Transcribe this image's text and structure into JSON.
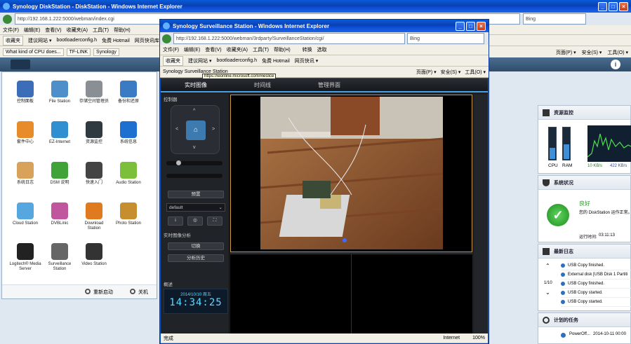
{
  "bg_window": {
    "title": "Synology DiskStation - DiskStation - Windows Internet Explorer",
    "address": "http://192.168.1.222:5000/webman/index.cgi",
    "search_placeholder": "Bing",
    "menu": [
      "文件(F)",
      "编辑(E)",
      "查看(V)",
      "收藏夹(A)",
      "工具(T)",
      "帮助(H)"
    ],
    "favorites_label": "收藏夹",
    "fav_links": [
      "建议网站 ▾",
      "bootloaderconfig.h",
      "免费 Hotmail",
      "网页快讯库 ▾"
    ],
    "tabs": [
      "What kind of CPU does...",
      "TF-LINK",
      "Synology"
    ],
    "right_tools": [
      "页面(P) ▾",
      "安全(S) ▾",
      "工具(O) ▾"
    ]
  },
  "dsm": {
    "apps": [
      {
        "label": "控制面板",
        "color": "#3b6db8"
      },
      {
        "label": "File Station",
        "color": "#4f8fc9"
      },
      {
        "label": "存储空间管理员",
        "color": "#8a8f96"
      },
      {
        "label": "备份和还原",
        "color": "#3a7bc4"
      },
      {
        "label": "套件中心",
        "color": "#e88b2a"
      },
      {
        "label": "EZ-Internet",
        "color": "#2f8fd0"
      },
      {
        "label": "资源监控",
        "color": "#2f3a40"
      },
      {
        "label": "系统信息",
        "color": "#1d6fd0"
      },
      {
        "label": "系统日志",
        "color": "#d9a25b"
      },
      {
        "label": "DSM 说明",
        "color": "#3fa33a"
      },
      {
        "label": "快速入门",
        "color": "#444"
      },
      {
        "label": "Audio Station",
        "color": "#7bbf3a"
      },
      {
        "label": "Cloud Station",
        "color": "#56a7e0"
      },
      {
        "label": "DVBLinic",
        "color": "#c0569e"
      },
      {
        "label": "Download Station",
        "color": "#e07a1f"
      },
      {
        "label": "Photo Station",
        "color": "#c68e2f"
      },
      {
        "label": "Logitech® Media Server",
        "color": "#222"
      },
      {
        "label": "Surveillance Station",
        "color": "#666"
      },
      {
        "label": "Video Station",
        "color": "#333"
      }
    ],
    "restart_label": "重新启动",
    "shutdown_label": "关机"
  },
  "ss_window": {
    "title": "Synology Surveillance Station - Windows Internet Explorer",
    "address": "http://192.168.1.222:5000/webman/3rdparty/SurveillanceStation/cgi/",
    "search_placeholder": "Bing",
    "menu": [
      "文件(F)",
      "编辑(E)",
      "查看(V)",
      "收藏夹(A)",
      "工具(T)",
      "帮助(H)"
    ],
    "translate_label": "转换",
    "select_label": "选取",
    "favorites_label": "收藏夹",
    "fav_links": [
      "建议网站 ▾",
      "bootloaderconfig.h",
      "免费 Hotmail",
      "网页快讯 ▾"
    ],
    "page_tab": "Synology Surveillance Station",
    "tooltip_url": "https://ieonline.microsoft.com/#ieslice",
    "right_tools": [
      "页面(P) ▾",
      "安全(S) ▾",
      "工具(O) ▾"
    ],
    "nav": [
      "实时图像",
      "时间线",
      "管理界面"
    ],
    "control_title": "控制器",
    "preset_label": "预置",
    "preset_value": "default",
    "analytics_title": "实时图像分析",
    "switch_label": "切换",
    "analytics_history": "分析历史",
    "overview_title": "概述",
    "clock_date": "2014/10/10 周五",
    "clock_time": "14:34:25",
    "status_done": "完成",
    "status_zone": "Internet",
    "zoom": "100%"
  },
  "widgets": {
    "resource_title": "资源监控",
    "cpu_label": "CPU",
    "ram_label": "RAM",
    "cpu_level": 0.35,
    "ram_level": 0.45,
    "upload": "10 KB/s",
    "download": "422 KB/s",
    "health_title": "系统状况",
    "health_status": "良好",
    "health_desc": "您的 DiskStation 运作正常。",
    "uptime_label": "运行时间:",
    "uptime_value": "03:11:13",
    "log_title": "最新日志",
    "log_page": "1/10",
    "logs": [
      "USB Copy finished.",
      "External disk [USB Disk 1 Partiti",
      "USB Copy finished.",
      "USB Copy started.",
      "USB Copy started."
    ],
    "task_title": "计划的任务",
    "task_name": "PowerOff...",
    "task_time": "2014-10-11 00:00"
  },
  "colors": {
    "xp_blue": "#0a4ad0",
    "ss_accent": "#4a9fe0",
    "clock_cyan": "#5fd8ff",
    "good_green": "#2aa52a"
  }
}
